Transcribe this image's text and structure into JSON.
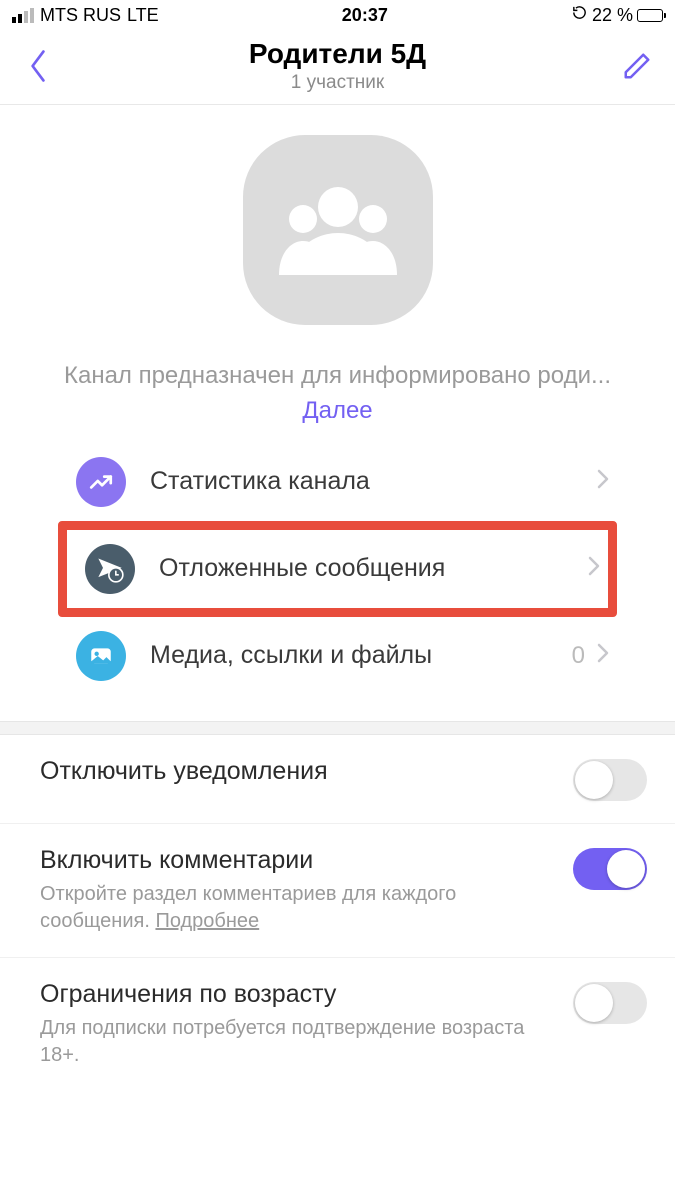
{
  "status": {
    "carrier": "MTS RUS",
    "network": "LTE",
    "time": "20:37",
    "battery_pct": "22 %"
  },
  "header": {
    "title": "Родители 5Д",
    "subtitle": "1 участник"
  },
  "description": {
    "text": "Канал предназначен для информировано роди...",
    "more_label": "Далее"
  },
  "menu": {
    "stats": {
      "label": "Статистика канала"
    },
    "scheduled": {
      "label": "Отложенные сообщения"
    },
    "media": {
      "label": "Медиа, ссылки и файлы",
      "count": "0"
    }
  },
  "settings": {
    "mute": {
      "title": "Отключить уведомления",
      "on": false
    },
    "comments": {
      "title": "Включить комментарии",
      "sub_a": "Откройте раздел комментариев для каждого сообщения.",
      "sub_link": "Подробнее",
      "on": true
    },
    "age": {
      "title": "Ограничения по возрасту",
      "sub": "Для подписки потребуется подтверждение возраста 18+.",
      "on": false
    }
  },
  "colors": {
    "accent": "#7360f2",
    "highlight_border": "#e84d3c"
  }
}
